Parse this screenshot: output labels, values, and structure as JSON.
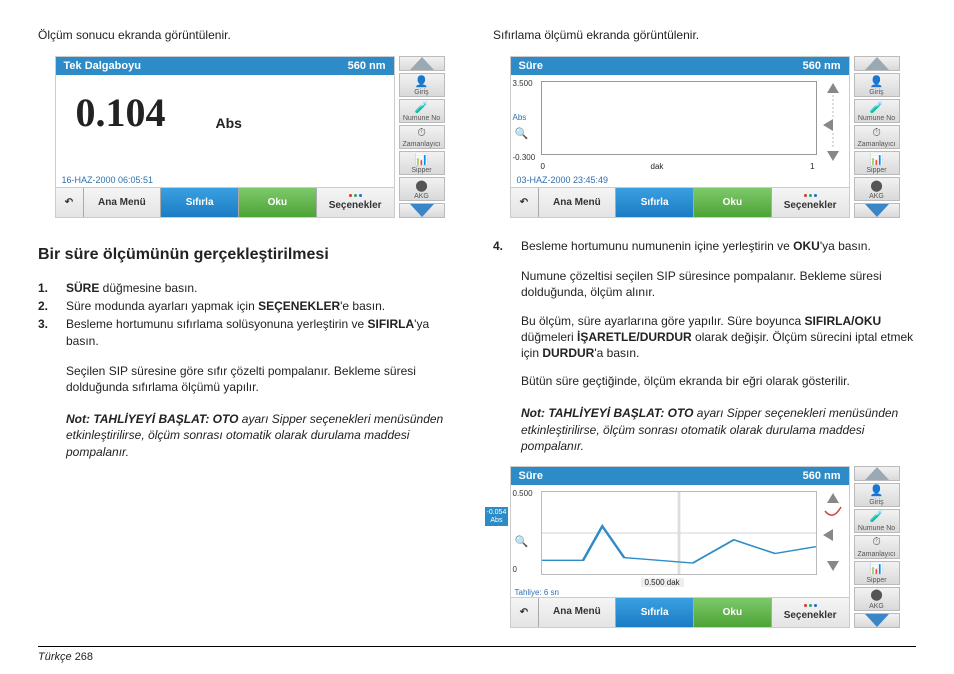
{
  "left": {
    "intro": "Ölçüm sonucu ekranda görüntülenir.",
    "screenshot1": {
      "title": "Tek Dalgaboyu",
      "wavelength": "560 nm",
      "value": "0.104",
      "unit": "Abs",
      "date": "16-HAZ-2000  06:05:51",
      "buttons": {
        "menu": "Ana Menü",
        "zero": "Sıfırla",
        "read": "Oku",
        "opts": "Seçenekler"
      },
      "right": {
        "login": "Giriş",
        "sample": "Numune No",
        "timer": "Zamanlayıcı",
        "sipper": "Sipper",
        "quality": "AKG"
      }
    },
    "heading": "Bir süre ölçümünün gerçekleştirilmesi",
    "steps": [
      {
        "n": "1.",
        "html": "<b>SÜRE</b> düğmesine basın."
      },
      {
        "n": "2.",
        "html": "Süre modunda ayarları yapmak için <b>SEÇENEKLER</b>'e basın."
      },
      {
        "n": "3.",
        "html": "Besleme hortumunu sıfırlama solüsyonuna yerleştirin ve <b>SIFIRLA</b>'ya basın."
      }
    ],
    "para": "Seçilen SIP süresine göre sıfır çözelti pompalanır. Bekleme süresi dolduğunda sıfırlama ölçümü yapılır.",
    "note": "<b>Not: TAHLİYEYİ BAŞLAT: OTO</b>  ayarı Sipper seçenekleri menüsünden etkinleştirilirse, ölçüm sonrası otomatik olarak durulama maddesi pompalanır."
  },
  "right": {
    "intro": "Sıfırlama ölçümü ekranda görüntülenir.",
    "screenshot2": {
      "title": "Süre",
      "wavelength": "560 nm",
      "y_hi": "3.500",
      "y_lo": "-0.300",
      "yaxis": "Abs",
      "x_lo": "0",
      "x_lab": "dak",
      "x_hi": "1",
      "date": "03-HAZ-2000  23:45:49",
      "buttons": {
        "menu": "Ana Menü",
        "zero": "Sıfırla",
        "read": "Oku",
        "opts": "Seçenekler"
      }
    },
    "steps": [
      {
        "n": "4.",
        "html": "Besleme hortumunu numunenin içine yerleştirin ve <b>OKU</b>'ya basın."
      }
    ],
    "paras": [
      "Numune çözeltisi seçilen SIP süresince pompalanır. Bekleme süresi dolduğunda, ölçüm alınır.",
      "Bu ölçüm, süre ayarlarına göre yapılır. Süre boyunca <b>SIFIRLA/OKU</b> düğmeleri <b>İŞARETLE/DURDUR</b> olarak değişir. Ölçüm sürecini iptal etmek için <b>DURDUR</b>'a basın.",
      "Bütün süre geçtiğinde, ölçüm ekranda bir eğri olarak gösterilir."
    ],
    "note": "<b>Not: TAHLİYEYİ BAŞLAT: OTO</b>  ayarı Sipper seçenekleri menüsünden etkinleştirilirse, ölçüm sonrası otomatik olarak durulama maddesi pompalanır.",
    "screenshot3": {
      "title": "Süre",
      "wavelength": "560 nm",
      "y_hi": "0.500",
      "y_lo": "0",
      "badge_val": "-0.054",
      "badge_unit": "Abs",
      "x_lab": "0.500 dak",
      "tahliye": "Tahliye: 6 sn",
      "buttons": {
        "menu": "Ana Menü",
        "zero": "Sıfırla",
        "read": "Oku",
        "opts": "Seçenekler"
      }
    },
    "rbtns": {
      "login": "Giriş",
      "sample": "Numune No",
      "timer": "Zamanlayıcı",
      "sipper": "Sipper",
      "quality": "AKG"
    }
  },
  "footer": {
    "lang": "Türkçe",
    "page": "268"
  }
}
